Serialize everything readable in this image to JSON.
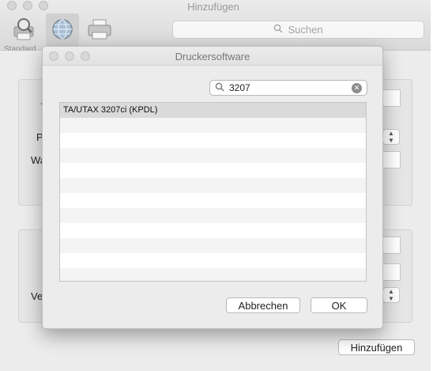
{
  "window": {
    "title": "Hinzufügen",
    "toolbar": {
      "standard_label": "Standard",
      "search_placeholder": "Suchen"
    },
    "labels": [
      "A",
      "P",
      "Wa",
      "Ve"
    ],
    "add_button": "Hinzufügen"
  },
  "dialog": {
    "title": "Druckersoftware",
    "search_value": "3207",
    "list_items": [
      "TA/UTAX 3207ci (KPDL)"
    ],
    "cancel_button": "Abbrechen",
    "ok_button": "OK"
  },
  "icons": {
    "standard": "printer-search-icon",
    "ip": "globe-icon",
    "windows": "printer-icon",
    "search": "magnifier-icon",
    "clear": "clear-x-icon"
  }
}
